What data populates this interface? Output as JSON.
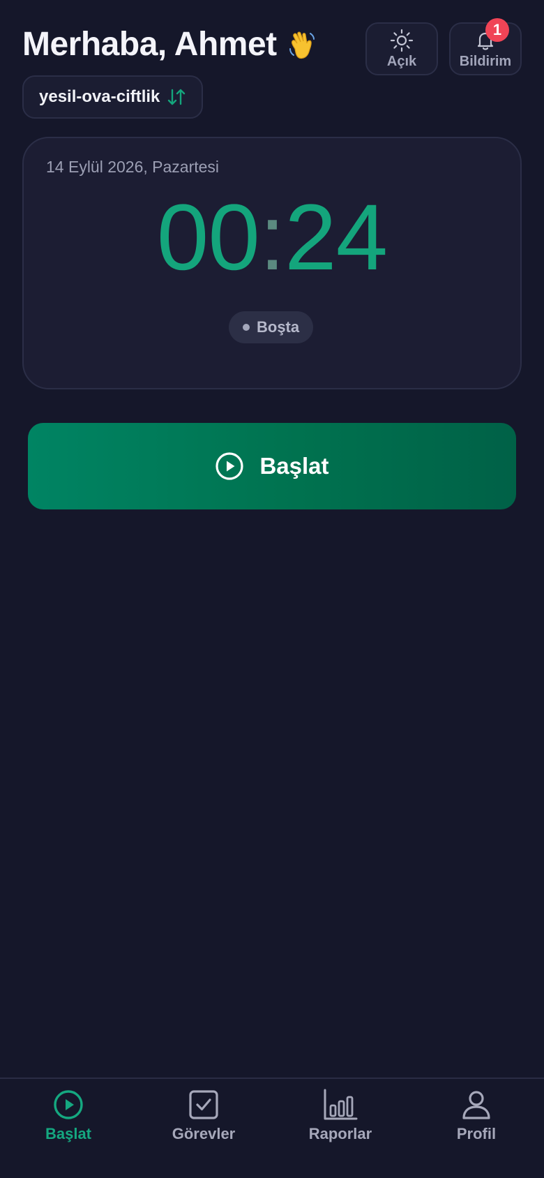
{
  "header": {
    "greeting": "Merhaba, Ahmet",
    "greeting_emoji": "👋",
    "farm_name": "yesil-ova-ciftlik",
    "theme_label": "Açık",
    "notification_label": "Bildirim",
    "notification_count": "1"
  },
  "timer": {
    "date": "14 Eylül 2026, Pazartesi",
    "minutes": "00",
    "separator": ":",
    "seconds": "24",
    "status": "Boşta"
  },
  "actions": {
    "start_label": "Başlat"
  },
  "tabs": [
    {
      "label": "Başlat",
      "icon": "play-circle-icon",
      "active": true
    },
    {
      "label": "Görevler",
      "icon": "checkbox-icon",
      "active": false
    },
    {
      "label": "Raporlar",
      "icon": "bar-chart-icon",
      "active": false
    },
    {
      "label": "Profil",
      "icon": "user-icon",
      "active": false
    }
  ],
  "colors": {
    "background": "#15172a",
    "accent": "#14a57c",
    "badge": "#f04456",
    "card": "#1c1d33"
  }
}
